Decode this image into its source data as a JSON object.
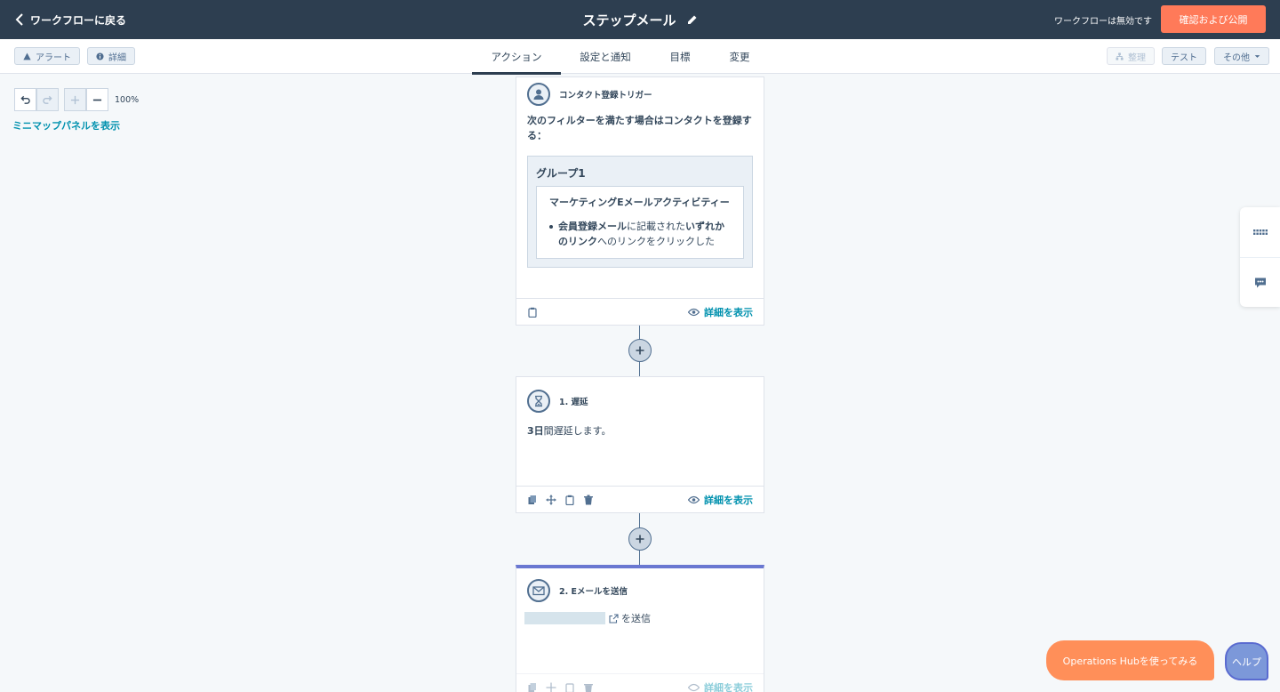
{
  "topbar": {
    "back_label": "ワークフローに戻る",
    "title": "ステップメール",
    "status": "ワークフローは無効です",
    "publish_label": "確認および公開"
  },
  "subbar": {
    "alert_label": "アラート",
    "details_label": "詳細",
    "tabs": [
      {
        "label": "アクション",
        "active": true
      },
      {
        "label": "設定と通知",
        "active": false
      },
      {
        "label": "目標",
        "active": false
      },
      {
        "label": "変更",
        "active": false
      }
    ],
    "organize_label": "整理",
    "test_label": "テスト",
    "more_label": "その他"
  },
  "canvas": {
    "zoom_level": "100%",
    "minimap_label": "ミニマップパネルを表示"
  },
  "trigger_card": {
    "title": "コンタクト登録トリガー",
    "description": "次のフィルターを満たす場合はコンタクトを登録する：",
    "group_title": "グループ1",
    "filter_title": "マーケティングEメールアクティビティー",
    "filter_part1": "会員登録メール",
    "filter_part2": "に記載された",
    "filter_part3": "いずれかのリンク",
    "filter_part4": "へのリンクをクリックした",
    "details_label": "詳細を表示"
  },
  "delay_card": {
    "title": "1. 遅延",
    "text_bold": "3日",
    "text_rest": "間遅延します。",
    "details_label": "詳細を表示"
  },
  "email_card": {
    "title": "2. Eメールを送信",
    "send_label": "を送信",
    "details_label": "詳細を表示"
  },
  "bottom": {
    "ops_label": "Operations Hubを使ってみる",
    "help_label": "ヘルプ"
  },
  "colors": {
    "topbar": "#2d3e50",
    "accent_orange": "#ff7a59",
    "link": "#0091ae",
    "email_accent": "#6a78d1"
  }
}
